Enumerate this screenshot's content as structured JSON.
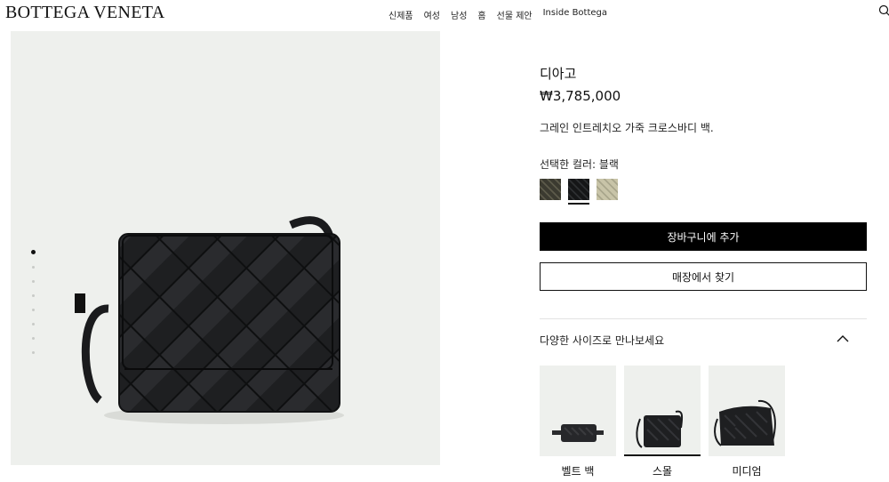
{
  "brand": "BOTTEGA VENETA",
  "nav": [
    "신제품",
    "여성",
    "남성",
    "홈",
    "선물 제안",
    "Inside Bottega"
  ],
  "product": {
    "name": "디아고",
    "price": "₩3,785,000",
    "description": "그레인 인트레치오 가죽 크로스바디 백.",
    "color_label": "선택한 컬러: 블랙",
    "swatches": [
      {
        "name": "olive",
        "color": "#4a4838"
      },
      {
        "name": "black",
        "color": "#1c1d1f",
        "selected": true
      },
      {
        "name": "beige",
        "color": "#bdb99d"
      }
    ]
  },
  "actions": {
    "add_to_cart": "장바구니에 추가",
    "find_in_store": "매장에서 찾기"
  },
  "sizes": {
    "title": "다양한 사이즈로 만나보세요",
    "options": [
      {
        "label": "벨트 백",
        "selected": false
      },
      {
        "label": "스몰",
        "selected": true
      },
      {
        "label": "미디엄",
        "selected": false
      }
    ]
  },
  "gallery": {
    "images": 8,
    "active_index": 0
  },
  "icons": {
    "search": "search-icon",
    "collapse": "chevron-up-icon"
  }
}
